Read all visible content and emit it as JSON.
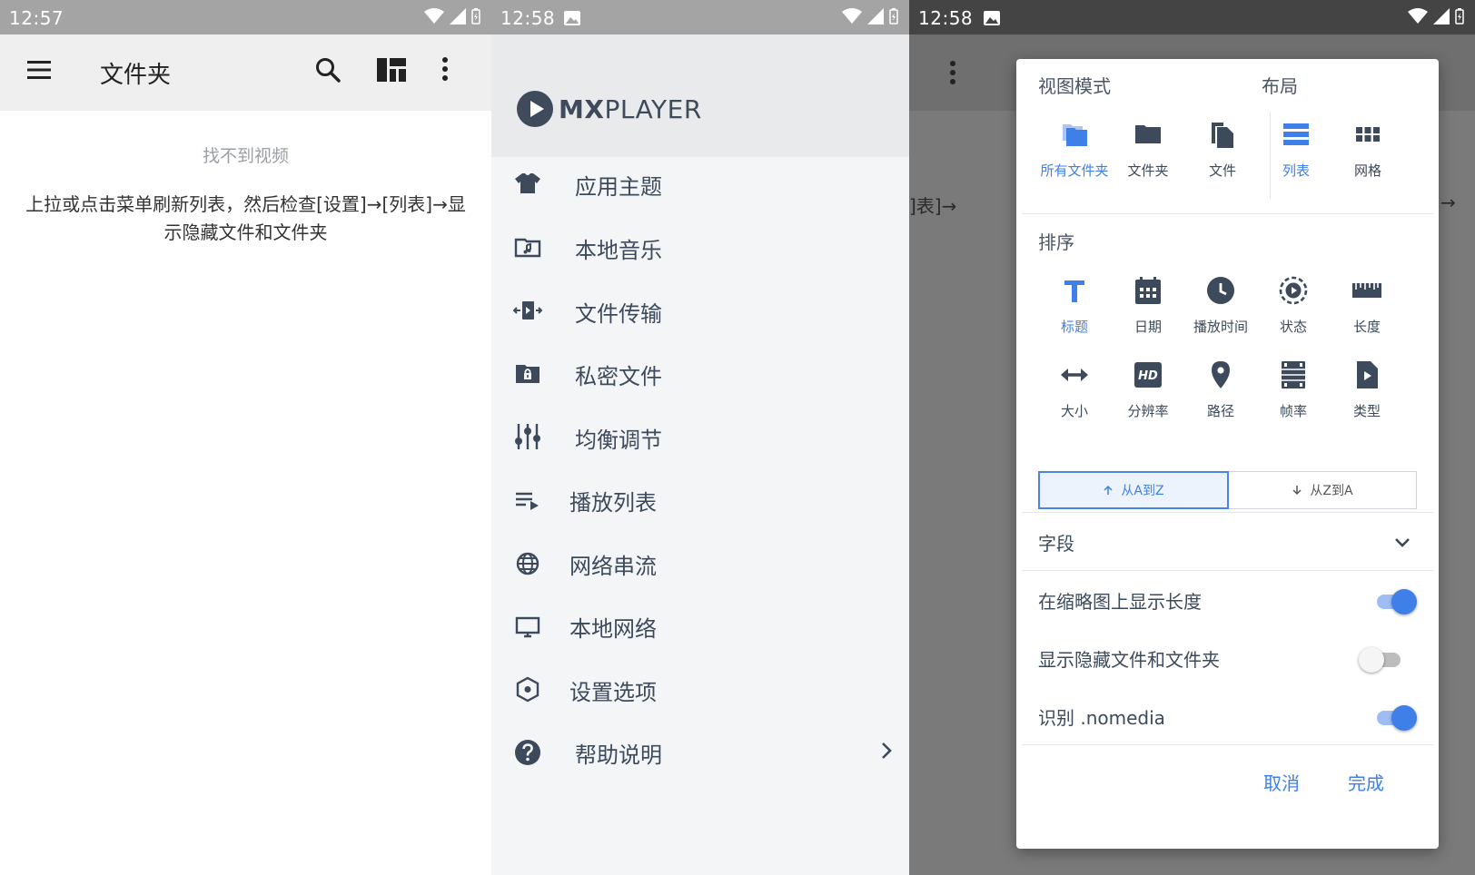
{
  "panel1": {
    "time": "12:57",
    "title": "文件夹",
    "empty_title": "找不到视频",
    "empty_message": "上拉或点击菜单刷新列表，然后检查[设置]→[列表]→显示隐藏文件和文件夹"
  },
  "panel2": {
    "time": "12:58",
    "logo_bold": "MX",
    "logo_rest": "PLAYER",
    "menu": [
      {
        "label": "应用主题",
        "icon": "shirt-icon"
      },
      {
        "label": "本地音乐",
        "icon": "music-folder-icon"
      },
      {
        "label": "文件传输",
        "icon": "file-transfer-icon"
      },
      {
        "label": "私密文件",
        "icon": "private-folder-icon"
      },
      {
        "label": "均衡调节",
        "icon": "equalizer-icon"
      },
      {
        "label": "播放列表",
        "icon": "playlist-icon"
      },
      {
        "label": "网络串流",
        "icon": "globe-icon"
      },
      {
        "label": "本地网络",
        "icon": "monitor-icon"
      },
      {
        "label": "设置选项",
        "icon": "settings-icon"
      },
      {
        "label": "帮助说明",
        "icon": "help-icon"
      }
    ]
  },
  "panel3": {
    "time": "12:58",
    "dialog": {
      "view_mode_title": "视图模式",
      "layout_title": "布局",
      "view_options": [
        {
          "label": "所有文件夹",
          "icon": "all-folders-icon",
          "selected": true
        },
        {
          "label": "文件夹",
          "icon": "folder-icon",
          "selected": false
        },
        {
          "label": "文件",
          "icon": "file-icon",
          "selected": false
        }
      ],
      "layout_options": [
        {
          "label": "列表",
          "icon": "list-icon",
          "selected": true
        },
        {
          "label": "网格",
          "icon": "grid-icon",
          "selected": false
        }
      ],
      "sort_title": "排序",
      "sort_options": [
        {
          "label": "标题",
          "icon": "title-icon",
          "selected": true
        },
        {
          "label": "日期",
          "icon": "calendar-icon",
          "selected": false
        },
        {
          "label": "播放时间",
          "icon": "clock-icon",
          "selected": false
        },
        {
          "label": "状态",
          "icon": "status-icon",
          "selected": false
        },
        {
          "label": "长度",
          "icon": "ruler-icon",
          "selected": false
        },
        {
          "label": "大小",
          "icon": "size-icon",
          "selected": false
        },
        {
          "label": "分辨率",
          "icon": "hd-icon",
          "selected": false
        },
        {
          "label": "路径",
          "icon": "location-pin-icon",
          "selected": false
        },
        {
          "label": "帧率",
          "icon": "film-icon",
          "selected": false
        },
        {
          "label": "类型",
          "icon": "file-type-icon",
          "selected": false
        }
      ],
      "sort_asc": "从A到Z",
      "sort_desc": "从Z到A",
      "fields_label": "字段",
      "toggles": [
        {
          "label": "在缩略图上显示长度",
          "on": true
        },
        {
          "label": "显示隐藏文件和文件夹",
          "on": false
        },
        {
          "label": "识别 .nomedia",
          "on": true
        }
      ],
      "cancel": "取消",
      "done": "完成"
    },
    "bg_text_left": "]表]→",
    "bg_text_right": "→"
  },
  "colors": {
    "accent": "#3f7fe8",
    "icon": "#3c4a5c",
    "status_gray": "#a4a4a4",
    "status_dark": "#444444"
  }
}
